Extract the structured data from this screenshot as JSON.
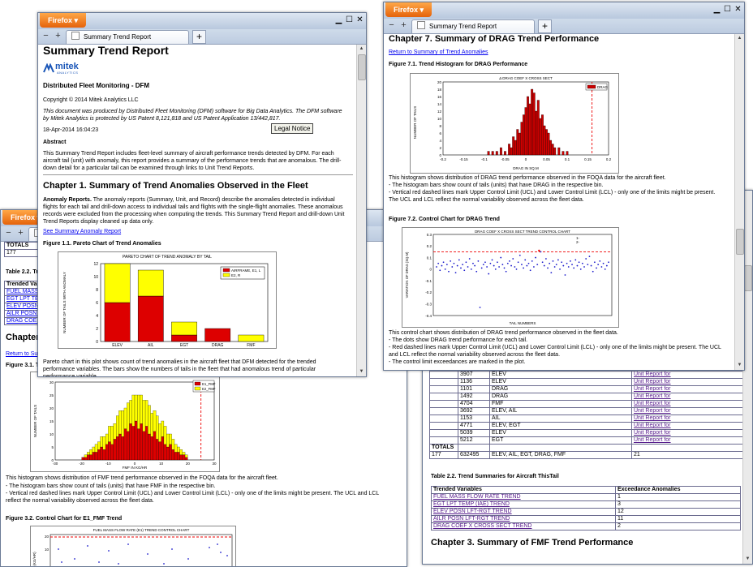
{
  "browser": {
    "menu_label": "Firefox",
    "tab_title": "Summary Trend Report",
    "back": "−",
    "forward": "+",
    "new_tab": "+"
  },
  "report": {
    "title": "Summary Trend Report",
    "logo_main": "mitek",
    "logo_sub": "ANALYTICS",
    "subtitle": "Distributed Fleet Monitoring - DFM",
    "copyright": "Copyright © 2014 Mitek Analytics LLC",
    "notice": "This document was produced by Distributed Fleet Monitoring (DFM) software for Big Data Analytics. The DFM software by Mitek Analytics is protected by US Patent 8,121,818 and US Patent Application 13/442,817.",
    "date": "18-Apr-2014 16:04:23",
    "legal_button": "Legal Notice",
    "abstract_label": "Abstract",
    "abstract_text": "This Summary Trend Report includes fleet-level summary of aircraft performance trends detected by DFM. For each aircraft tail (unit) with anomaly, this report provides a summary of the performance trends that are anomalous. The drill-down detail for a particular tail can be examined through links to Unit Trend Reports.",
    "ch1_title": "Chapter 1. Summary of Trend Anomalies Observed in the Fleet",
    "anomaly_label": "Anomaly Reports.",
    "anomaly_text": " The anomaly reports (Summary, Unit, and Record) describe the anomalies detected in individual flights for each tail and drill-down access to individual tails and flights with the single-flight anomalies. These anomalous records were excluded from the processing when computing the trends. This Summary Trend Report and drill-down Unit Trend Reports display cleaned up data only.",
    "see_link": "See Summary Anomaly Report",
    "fig11_caption": "Figure 1.1. Pareto Chart of Trend Anomalies",
    "pareto_text": "Pareto chart in this plot shows count of trend anomalies in the aircraft fleet that DFM detected for the trended performance variables. The bars show the numbers of tails in the fleet that had anomalous trend of particular performance variable."
  },
  "drag": {
    "ch7_title": "Chapter 7. Summary of DRAG Trend Performance",
    "return_link": "Return to Summary of Trend Anomalies",
    "fig71_caption": "Figure 7.1. Trend Histogram for DRAG Performance",
    "hist_text_1": "This histogram shows distribution of DRAG trend performance observed in the FOQA data for the aircraft fleet.",
    "hist_text_2": "- The histogram bars show count of tails (units) that have DRAG in the respective bin.",
    "hist_text_3": "- Vertical red dashed lines mark Upper Control Limit (UCL) and Lower Control Limit (LCL) - only one of the limits might be present. The UCL and LCL reflect the normal variability observed across the fleet data.",
    "fig72_caption": "Figure 7.2. Control Chart for DRAG Trend",
    "cc_text_1": "This control chart shows distribution of DRAG trend performance observed in the fleet data.",
    "cc_text_2": "- The dots show DRAG trend performance for each tail.",
    "cc_text_3": "- Red dashed lines mark Upper Control Limit (UCL) and Lower Control Limit (LCL) - only one of the limits might be present. The UCL and LCL reflect the normal variability observed across the fleet data.",
    "cc_text_4": "- The control limit exceedances are marked in the plot."
  },
  "back_left": {
    "totals_label": "TOTALS",
    "totals_value": "177",
    "table_caption": "Table 2.2. Tre",
    "col": "Trended Varia",
    "rows": [
      "FUEL MASS F",
      "EGT LPT TEM",
      "ELEV POSN L",
      "AILR POSN L",
      "DRAG COEF"
    ],
    "chapter": "Chapter",
    "return": "Return to Sum",
    "fig31": "Figure 3.1. Tr",
    "fmf_text_1": "This histogram shows distribution of FMF trend performance observed in the FOQA data for the aircraft fleet.",
    "fmf_text_2": "- The histogram bars show count of tails (units) that have FMF in the respective bin.",
    "fmf_text_3": "- Vertical red dashed lines mark Upper Control Limit (UCL) and Lower Control Limit (LCL) - only one of the limits might be present. The UCL and LCL reflect the normal variability observed across the fleet data.",
    "fig32": "Figure 3.2. Control Chart for E1_FMF Trend"
  },
  "back_right": {
    "units": [
      {
        "id": "4566",
        "var": "ELEV"
      },
      {
        "id": "3907",
        "var": "ELEV"
      },
      {
        "id": "1136",
        "var": "ELEV"
      },
      {
        "id": "1101",
        "var": "DRAG"
      },
      {
        "id": "1492",
        "var": "DRAG"
      },
      {
        "id": "4704",
        "var": "FMF"
      },
      {
        "id": "3692",
        "var": "ELEV, AIL"
      },
      {
        "id": "1153",
        "var": "AIL"
      },
      {
        "id": "4771",
        "var": "ELEV, EGT"
      },
      {
        "id": "5039",
        "var": "ELEV"
      },
      {
        "id": "5212",
        "var": "EGT"
      }
    ],
    "unit_link": "Unit Report for",
    "totals_label": "TOTALS",
    "totals_count": "177",
    "totals_tail": "632495",
    "totals_vars": "ELEV, AIL, EGT, DRAG, FMF",
    "totals_num": "21",
    "table_caption": "Table 2.2. Trend Summaries for Aircraft ThisTail",
    "col1": "Trended Variables",
    "col2": "Exceedance Anomalies",
    "rows": [
      {
        "name": "FUEL MASS FLOW RATE TREND",
        "count": "1"
      },
      {
        "name": "EGT LPT TEMP (IAE) TREND",
        "count": "3"
      },
      {
        "name": "ELEV POSN LFT-RGT TREND",
        "count": "12"
      },
      {
        "name": "AILR POSN LFT-RGT TREND",
        "count": "11"
      },
      {
        "name": "DRAG COEF X CROSS SECT TREND",
        "count": "2"
      }
    ],
    "ch3_title": "Chapter 3. Summary of FMF Trend Performance"
  },
  "chart_data": [
    {
      "type": "bar",
      "title": "PARETO CHART OF TREND ANOMALY BY TAIL",
      "ylabel": "NUMBER OF TAILS WITH ANOMALY",
      "categories": [
        "ELEV",
        "AIL",
        "EGT",
        "DRAG",
        "FMF"
      ],
      "series": [
        {
          "name": "AIRFRAME, E1, L",
          "values": [
            6,
            7,
            1,
            2,
            0
          ]
        },
        {
          "name": "E2, R",
          "values": [
            6,
            4,
            2,
            0,
            1
          ]
        }
      ],
      "ylim": [
        0,
        12
      ],
      "yticks": [
        "0",
        "2",
        "4",
        "6",
        "8",
        "10",
        "12"
      ],
      "colors": [
        "#dd0000",
        "#ffff00"
      ]
    },
    {
      "type": "bar",
      "title": "Δ DRAG COEF X CROSS SECT",
      "xlabel": "DRAG IN SQ.M",
      "ylabel": "NUMBER OF TAILS",
      "legend": "DRAG",
      "x": [
        -0.09,
        -0.08,
        -0.07,
        -0.06,
        -0.05,
        -0.04,
        -0.035,
        -0.03,
        -0.025,
        -0.02,
        -0.015,
        -0.01,
        -0.005,
        0.0,
        0.005,
        0.01,
        0.015,
        0.02,
        0.025,
        0.03,
        0.035,
        0.04,
        0.045,
        0.05,
        0.055,
        0.06,
        0.065,
        0.07,
        0.08,
        0.09,
        0.1
      ],
      "values": [
        1,
        1,
        1,
        2,
        1,
        3,
        2,
        5,
        4,
        7,
        6,
        9,
        11,
        13,
        16,
        14,
        18,
        17,
        12,
        15,
        10,
        11,
        8,
        7,
        6,
        4,
        3,
        2,
        2,
        1,
        1
      ],
      "xlim": [
        -0.2,
        0.2
      ],
      "xticks": [
        "-0.2",
        "-0.15",
        "-0.1",
        "-0.05",
        "0",
        "0.05",
        "0.1",
        "0.15",
        "0.2"
      ],
      "ylim": [
        0,
        20
      ],
      "yticks": [
        "0",
        "2",
        "4",
        "6",
        "8",
        "10",
        "12",
        "14",
        "16",
        "18",
        "20"
      ],
      "ucl": 0.16,
      "color": "#cc0000"
    },
    {
      "type": "scatter",
      "title": "DRAG COEF X CROSS SECT TREND CONTROL CHART",
      "xlabel": "TAIL NUMBERS",
      "ylabel": "VARIATION OF DRAG (SQ.M)",
      "ylim": [
        -0.4,
        0.3
      ],
      "yticks": [
        "0.3",
        "0.2",
        "0.1",
        "0",
        "-0.1",
        "-0.2",
        "-0.3",
        "-0.4"
      ],
      "ucl": 0.15,
      "legend": [
        "1-",
        "2-"
      ],
      "values": [
        0.02,
        0.05,
        -0.01,
        0.03,
        0.06,
        0.0,
        0.04,
        -0.02,
        0.07,
        0.02,
        0.05,
        -0.03,
        0.03,
        0.08,
        0.01,
        0.04,
        -0.01,
        0.06,
        0.02,
        0.09,
        0.0,
        0.05,
        0.03,
        -0.02,
        0.07,
        -0.33,
        0.01,
        0.04,
        0.06,
        0.02,
        -0.04,
        0.05,
        0.08,
        0.03,
        0.0,
        0.06,
        0.02,
        0.1,
        0.04,
        0.01,
        -0.02,
        0.05,
        0.07,
        0.03,
        0.09,
        0.02,
        0.0,
        0.06,
        0.12,
        0.04,
        0.01,
        0.08,
        0.03,
        0.05,
        -0.01,
        0.07,
        0.02,
        0.1,
        0.04,
        0.16,
        0.15,
        0.06,
        0.03,
        0.09,
        0.01,
        0.05,
        -0.03,
        0.07,
        0.02,
        0.04,
        0.08,
        0.0,
        0.06,
        0.03,
        -0.05,
        0.05,
        0.02,
        0.07,
        0.04,
        0.01,
        0.08,
        0.03,
        0.06,
        0.0,
        0.05,
        0.02,
        0.09,
        0.04,
        0.11,
        0.03,
        -0.02,
        0.06,
        0.01,
        0.04,
        0.07,
        0.02,
        0.05,
        0.0,
        0.03,
        0.06
      ]
    },
    {
      "type": "bar",
      "title": "Δ FUEL MASS FLOW RATE",
      "xlabel": "FMF IN KG/HR",
      "ylabel": "NUMBER OF TAILS",
      "series": [
        {
          "name": "E1_FMF",
          "values": [
            1,
            1,
            2,
            2,
            3,
            3,
            4,
            5,
            4,
            6,
            7,
            6,
            8,
            9,
            10,
            9,
            12,
            11,
            14,
            13,
            15,
            12,
            14,
            11,
            13,
            10,
            9,
            11,
            8,
            7,
            9,
            6,
            5,
            6,
            4,
            3,
            3,
            2,
            2,
            1
          ]
        },
        {
          "name": "E2_FMF",
          "values": [
            0,
            1,
            1,
            2,
            2,
            3,
            3,
            4,
            5,
            4,
            6,
            7,
            6,
            8,
            9,
            10,
            8,
            11,
            9,
            12,
            10,
            13,
            11,
            12,
            10,
            11,
            9,
            8,
            9,
            7,
            6,
            7,
            5,
            4,
            4,
            3,
            2,
            2,
            1,
            1
          ]
        }
      ],
      "xlim": [
        -30,
        30
      ],
      "xticks": [
        "-30",
        "-20",
        "-10",
        "0",
        "10",
        "20",
        "30"
      ],
      "ylim": [
        0,
        30
      ],
      "yticks": [
        "0",
        "5",
        "10",
        "15",
        "20",
        "25",
        "30"
      ],
      "ucl": 25,
      "colors": [
        "#dd0000",
        "#ffff00"
      ]
    },
    {
      "type": "scatter",
      "title": "FUEL MASS FLOW RATE (E1) TREND CONTROL CHART",
      "ylabel": "(KG/HR)",
      "yticks": [
        "20",
        "10"
      ],
      "ylim": [
        -10,
        25
      ]
    }
  ]
}
